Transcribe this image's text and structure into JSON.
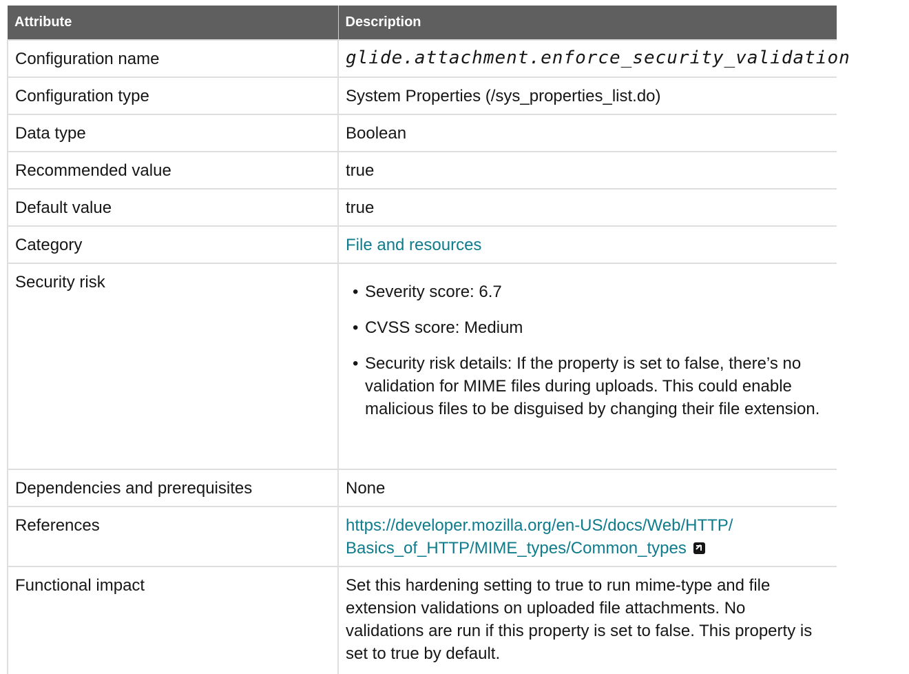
{
  "table": {
    "headers": {
      "attribute": "Attribute",
      "description": "Description"
    },
    "rows": {
      "config_name": {
        "label": "Configuration name",
        "value": "glide.attachment.enforce_security_validation"
      },
      "config_type": {
        "label": "Configuration type",
        "value": "System Properties (/sys_properties_list.do)"
      },
      "data_type": {
        "label": "Data type",
        "value": "Boolean"
      },
      "recommended": {
        "label": "Recommended value",
        "value": "true"
      },
      "default": {
        "label": "Default value",
        "value": "true"
      },
      "category": {
        "label": "Category",
        "value": "File and resources"
      },
      "security_risk": {
        "label": "Security risk",
        "items": [
          "Severity score: 6.7",
          "CVSS score: Medium",
          "Security risk details: If the property is set to false, there’s no validation for MIME files during uploads. This could enable malicious files to be disguised by changing their file extension."
        ]
      },
      "dependencies": {
        "label": "Dependencies and prerequisites",
        "value": "None"
      },
      "references": {
        "label": "References",
        "link_line1": "https://developer.mozilla.org/en-US/docs/Web/HTTP/",
        "link_line2": "Basics_of_HTTP/MIME_types/Common_types",
        "icon": "external-link-icon"
      },
      "functional_impact": {
        "label": "Functional impact",
        "value": "Set this hardening setting to true to run mime-type and file extension validations on uploaded file attachments. No validations are run if this property is set to false. This property is set to true by default."
      }
    }
  },
  "colors": {
    "header_bg": "#5f5f5f",
    "link": "#0e7c8c",
    "border": "#dedede"
  }
}
